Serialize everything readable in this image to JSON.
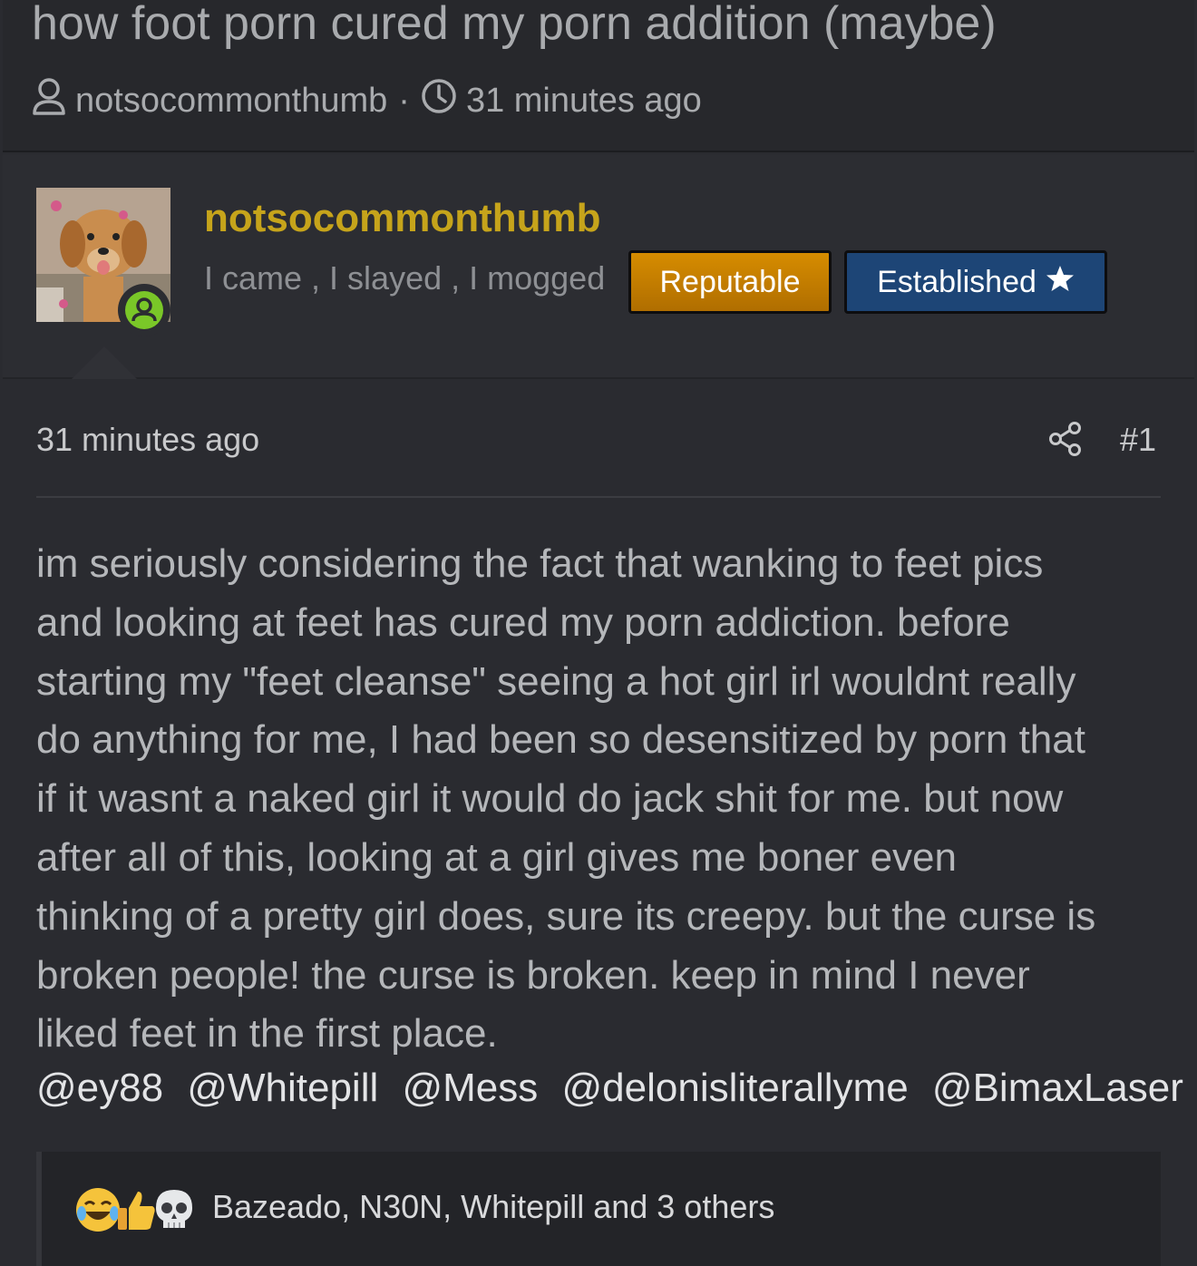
{
  "thread": {
    "title": "how foot porn cured my porn addition (maybe)",
    "author": "notsocommonthumb",
    "separator": "·",
    "time": "31 minutes ago"
  },
  "author_block": {
    "name": "notsocommonthumb",
    "tagline": "I came , I slayed , I mogged",
    "badges": [
      {
        "label": "Reputable",
        "color": "#d68c00"
      },
      {
        "label": "Established",
        "color": "#1d4576"
      }
    ],
    "online_color": "#7ac728"
  },
  "post": {
    "time": "31 minutes ago",
    "number": "#1",
    "lines": [
      "im seriously considering the fact that wanking to feet pics",
      "and looking at feet has cured my porn addiction. before",
      "starting my \"feet cleanse\" seeing a hot girl irl wouldnt really",
      "do anything for me, I had been so desensitized by porn that",
      "if it wasnt a naked girl it would do jack shit for me. but now",
      "after all of this, looking at a girl gives me boner even",
      "thinking of a pretty girl does, sure its creepy. but the curse is",
      "broken people! the curse is broken. keep in mind I never",
      "liked feet in the first place."
    ],
    "mentions": [
      "@ey88",
      "@Whitepill",
      "@Mess",
      "@delonisliterallyme",
      "@BimaxLaser"
    ]
  },
  "reactions": {
    "icons": [
      "laughing-crying-emoji",
      "thumbs-up-emoji",
      "skull-emoji"
    ],
    "text": "Bazeado, N30N, Whitepill and 3 others"
  }
}
